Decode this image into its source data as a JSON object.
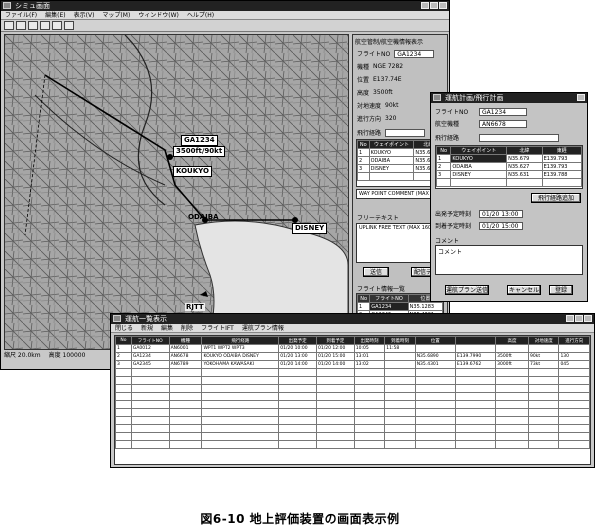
{
  "main_window": {
    "title": "シミュ画面",
    "menu": [
      "ファイル(F)",
      "編集(E)",
      "表示(V)",
      "マップ(M)",
      "ウィンドウ(W)",
      "ヘルプ(H)"
    ]
  },
  "map": {
    "flight_label": "GA1234",
    "flight_info": "3500ft/90kt",
    "waypoints": [
      "KOUKYO",
      "ODAIBA",
      "DISNEY",
      "RJTT"
    ],
    "scale_label": "縮尺 20.0km",
    "status_left": "縮尺 20.0km",
    "status_right": "高度 100000"
  },
  "flight_panel": {
    "title": "航空管制/航空機情報表示",
    "fields": [
      {
        "label": "フライトNO",
        "value": "GA1234"
      },
      {
        "label": "機種",
        "value": "NGE 7282"
      },
      {
        "label": "位置",
        "value": "E137.74E"
      },
      {
        "label": "高度",
        "value": "3500ft"
      },
      {
        "label": "対地速度",
        "value": "90kt"
      },
      {
        "label": "進行方向",
        "value": "320"
      }
    ],
    "route_label": "飛行経路",
    "route_headers": [
      "No",
      "ウェイポイント",
      "北緯",
      "東経"
    ],
    "route_rows": [
      [
        "1",
        "KOUKYO",
        "N35.679",
        ""
      ],
      [
        "2",
        "ODAIBA",
        "N35.627",
        ""
      ],
      [
        "3",
        "DISNEY",
        "N35.631",
        ""
      ]
    ],
    "waypoint_comment": "WAY POINT COMMENT (MAX 160)",
    "free_text_label": "フリーテキスト",
    "free_text": "UPLINK FREE TEXT (MAX 160)",
    "btn_send": "送信",
    "btn_edit": "配信テキ",
    "flight_list_label": "フライト情報一覧",
    "flight_list_headers": [
      "No",
      "フライトNO",
      "位置"
    ],
    "flight_list_rows": [
      [
        "1",
        "GA1234",
        "N35.1283"
      ],
      [
        "2",
        "GA2345",
        "N35.4301"
      ]
    ]
  },
  "plan_dialog": {
    "title": "運航計画/飛行計画",
    "fields": [
      {
        "label": "フライトNO",
        "value": "GA1234"
      },
      {
        "label": "航空機種",
        "value": "AN6678"
      },
      {
        "label": "飛行経路",
        "value": ""
      }
    ],
    "route_headers": [
      "No",
      "ウェイポイント",
      "北緯",
      "東経"
    ],
    "route_rows": [
      [
        "1",
        "KOUKYO",
        "N35.679",
        "E139.793"
      ],
      [
        "2",
        "ODAIBA",
        "N35.627",
        "E139.793"
      ],
      [
        "3",
        "DISNEY",
        "N35.631",
        "E139.788"
      ]
    ],
    "btn_insert": "飛行経路追加",
    "dep_label": "出発予定時刻",
    "dep_value": "01/20 13:00",
    "arr_label": "到着予定時刻",
    "arr_value": "01/20 15:00",
    "comment_label": "コメント",
    "comment_value": "コメント",
    "btn_uplink": "運航プラン送信",
    "btn_cancel": "キャンセル",
    "btn_ok": "登録"
  },
  "list_window": {
    "title": "運航一覧表示",
    "menu": [
      "閉じる",
      "新規",
      "編集",
      "削除",
      "フライトIFT",
      "運航プラン情報"
    ],
    "headers": [
      "No",
      "フライトNO",
      "機種",
      "飛行経路",
      "出発予定",
      "到着予定",
      "出発時刻",
      "到着時刻",
      "位置",
      "",
      "高度",
      "対地速度",
      "進行方向"
    ],
    "rows": [
      [
        "1",
        "GA0012",
        "AN6001",
        "WPT1 WPT2 WPT3",
        "01/20 10:00",
        "01/20 12:00",
        "10:05",
        "11:58",
        "",
        "",
        "",
        "",
        ""
      ],
      [
        "2",
        "GA1234",
        "AN6678",
        "KOUKYO ODAIBA DISNEY",
        "01/20 13:00",
        "01/20 15:00",
        "13:01",
        "",
        "N35.6890",
        "E139.7990",
        "3500ft",
        "90kt",
        "130"
      ],
      [
        "3",
        "GA2345",
        "AN6789",
        "YOKOHAMA KAWASAKI",
        "01/20 14:00",
        "01/20 14:00",
        "13:02",
        "",
        "N35.4301",
        "E139.6762",
        "3000ft",
        "73kt",
        "045"
      ]
    ]
  },
  "caption": "図6-10 地上評価装置の画面表示例",
  "colors": {
    "titlebar": "#222222",
    "window": "#c8c8c8",
    "map_bg": "#9a9a9a"
  }
}
